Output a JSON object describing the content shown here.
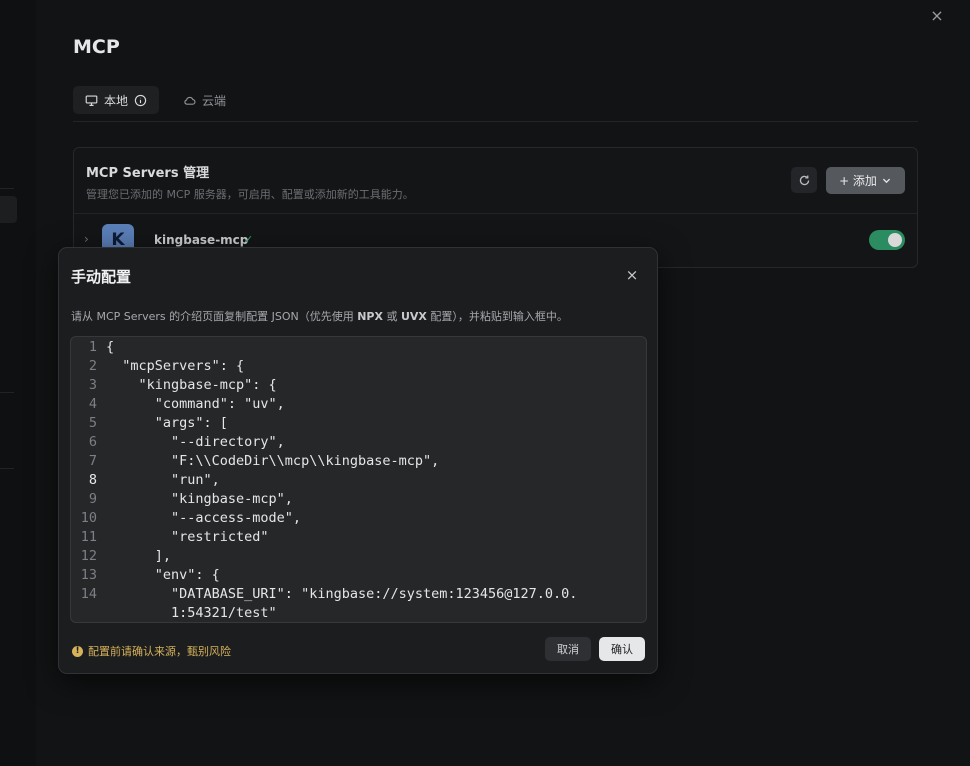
{
  "panel": {
    "title": "MCP",
    "close_icon": "×",
    "tabs": [
      {
        "label": "本地",
        "icon": "monitor-icon",
        "active": true
      },
      {
        "label": "云端",
        "icon": "cloud-icon",
        "active": false
      }
    ]
  },
  "card": {
    "title": "MCP Servers 管理",
    "subtitle": "管理您已添加的 MCP 服务器，可启用、配置或添加新的工具能力。",
    "add_label": "+ 添加",
    "server": {
      "logo_letter": "K",
      "name": "kingbase-mcp",
      "check": "✓",
      "enabled": true
    }
  },
  "modal": {
    "title": "手动配置",
    "close_icon": "×",
    "desc_prefix": "请从 MCP Servers 的介绍页面复制配置 JSON（优先使用 ",
    "desc_npx": "NPX",
    "desc_mid": " 或 ",
    "desc_uvx": "UVX",
    "desc_suffix": " 配置），并粘贴到输入框中。",
    "code_lines": [
      {
        "n": "1",
        "t": "{"
      },
      {
        "n": "2",
        "t": "  \"mcpServers\": {"
      },
      {
        "n": "3",
        "t": "    \"kingbase-mcp\": {"
      },
      {
        "n": "4",
        "t": "      \"command\": \"uv\","
      },
      {
        "n": "5",
        "t": "      \"args\": ["
      },
      {
        "n": "6",
        "t": "        \"--directory\","
      },
      {
        "n": "7",
        "t": "        \"F:\\\\CodeDir\\\\mcp\\\\kingbase-mcp\","
      },
      {
        "n": "8",
        "t": "        \"run\","
      },
      {
        "n": "9",
        "t": "        \"kingbase-mcp\","
      },
      {
        "n": "10",
        "t": "        \"--access-mode\","
      },
      {
        "n": "11",
        "t": "        \"restricted\""
      },
      {
        "n": "12",
        "t": "      ],"
      },
      {
        "n": "13",
        "t": "      \"env\": {"
      },
      {
        "n": "14",
        "t": "        \"DATABASE_URI\": \"kingbase://system:123456@127.0.0."
      },
      {
        "n": "",
        "t": "        1:54321/test\""
      }
    ],
    "current_line": "8",
    "warning": "配置前请确认来源，甄别风险",
    "cancel_label": "取消",
    "confirm_label": "确认"
  }
}
